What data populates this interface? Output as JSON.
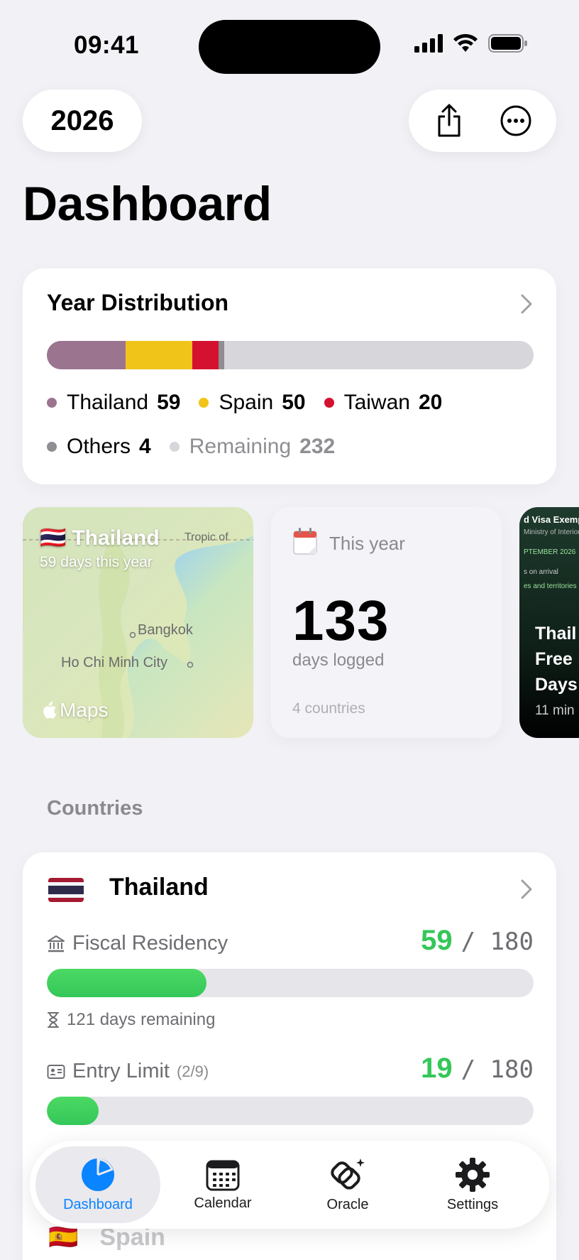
{
  "status_bar": {
    "time": "09:41"
  },
  "header": {
    "year": "2026",
    "title": "Dashboard"
  },
  "year_distribution": {
    "title": "Year Distribution",
    "total_days": 365,
    "segments": [
      {
        "name": "Thailand",
        "value": 59,
        "color": "#9b7590"
      },
      {
        "name": "Spain",
        "value": 50,
        "color": "#f0c419"
      },
      {
        "name": "Taiwan",
        "value": 20,
        "color": "#d4122f"
      },
      {
        "name": "Others",
        "value": 4,
        "color": "#8e8e93"
      },
      {
        "name": "Remaining",
        "value": 232,
        "color": "#d6d6db"
      }
    ],
    "labels": {
      "thailand": "Thailand",
      "thailand_val": "59",
      "spain": "Spain",
      "spain_val": "50",
      "taiwan": "Taiwan",
      "taiwan_val": "20",
      "others": "Others",
      "others_val": "4",
      "remaining": "Remaining",
      "remaining_val": "232"
    }
  },
  "map_card": {
    "flag": "🇹🇭",
    "title": "Thailand",
    "subtitle": "59 days this year",
    "city_1": "Bangkok",
    "city_2": "Ho Chi Minh City",
    "map_label": "Tropic of",
    "brand": "Maps"
  },
  "year_card": {
    "label": "This year",
    "value": "133",
    "unit": "days logged",
    "footer": "4 countries"
  },
  "news_card": {
    "line_1": "d Visa Exemp",
    "line_2": "Ministry of Interior",
    "line_3": "PTEMBER 2026",
    "line_4": "s on arrival",
    "line_5": "es and territories",
    "head_1": "Thail",
    "head_2": "Free",
    "head_3": "Days",
    "meta": "11 min"
  },
  "countries": {
    "section_title": "Countries",
    "thailand": {
      "name": "Thailand",
      "fiscal": {
        "label": "Fiscal Residency",
        "value": "59",
        "limit": "/ 180",
        "progress": 0.328,
        "remaining": "121 days remaining"
      },
      "entry": {
        "label": "Entry Limit",
        "sub": "(2/9)",
        "value": "19",
        "limit": "/ 180",
        "progress": 0.106
      }
    },
    "next_peek": {
      "flag": "🇪🇸",
      "name": "Spain"
    }
  },
  "tabbar": {
    "dashboard": "Dashboard",
    "calendar": "Calendar",
    "oracle": "Oracle",
    "settings": "Settings"
  }
}
